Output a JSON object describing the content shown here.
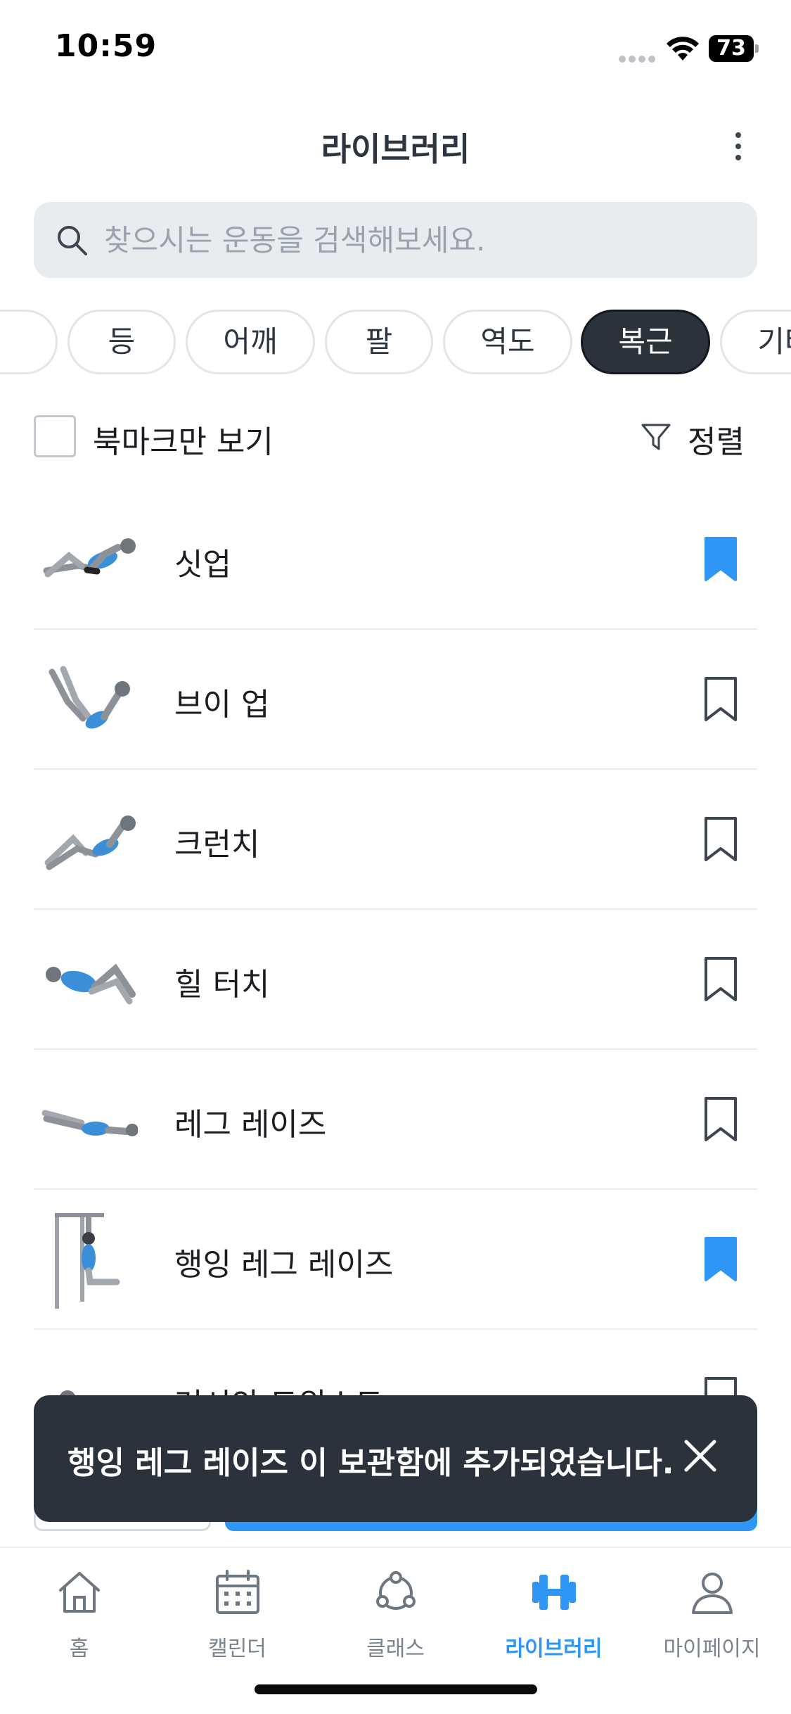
{
  "status_bar": {
    "time": "10:59",
    "battery": "73"
  },
  "header": {
    "title": "라이브러리",
    "more_icon": "more-vertical-icon"
  },
  "search": {
    "placeholder": "찾으시는 운동을 검색해보세요.",
    "value": "",
    "icon": "search-icon"
  },
  "categories": [
    {
      "label": ""
    },
    {
      "label": "등"
    },
    {
      "label": "어깨"
    },
    {
      "label": "팔"
    },
    {
      "label": "역도"
    },
    {
      "label": "복근",
      "active": true
    },
    {
      "label": "기타"
    }
  ],
  "filter": {
    "bookmark_only_label": "북마크만 보기",
    "bookmark_only_checked": false,
    "sort_label": "정렬",
    "sort_icon": "filter-icon"
  },
  "exercises": [
    {
      "name": "싯업",
      "bookmarked": true
    },
    {
      "name": "브이 업",
      "bookmarked": false
    },
    {
      "name": "크런치",
      "bookmarked": false
    },
    {
      "name": "힐 터치",
      "bookmarked": false
    },
    {
      "name": "레그 레이즈",
      "bookmarked": false
    },
    {
      "name": "행잉 레그 레이즈",
      "bookmarked": true
    },
    {
      "name": "러시안 트위스트",
      "bookmarked": false
    }
  ],
  "toast": {
    "message": "행잉 레그 레이즈 이 보관함에 추가되었습니다.",
    "close_icon": "close-icon"
  },
  "tab_bar": [
    {
      "label": "홈",
      "icon": "home-icon"
    },
    {
      "label": "캘린더",
      "icon": "calendar-icon"
    },
    {
      "label": "클래스",
      "icon": "share-nodes-icon"
    },
    {
      "label": "라이브러리",
      "icon": "dumbbell-icon",
      "active": true
    },
    {
      "label": "마이페이지",
      "icon": "person-icon"
    }
  ],
  "colors": {
    "accent": "#2f96f5",
    "dark": "#2b323b",
    "muted": "#7a838d"
  }
}
